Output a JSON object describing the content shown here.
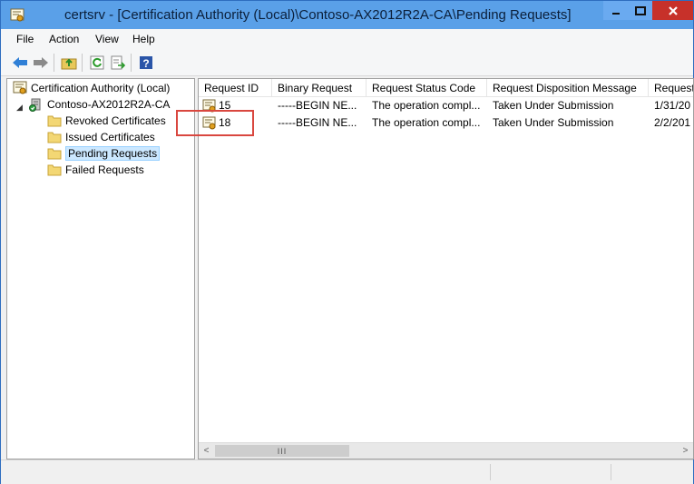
{
  "window": {
    "title": "certsrv - [Certification Authority (Local)\\Contoso-AX2012R2A-CA\\Pending Requests]"
  },
  "menu": [
    "File",
    "Action",
    "View",
    "Help"
  ],
  "toolbar": {
    "buttons": [
      "back-arrow-icon",
      "forward-arrow-icon",
      "up-folder-icon",
      "refresh-icon",
      "export-list-icon",
      "help-icon"
    ]
  },
  "tree": {
    "root": "Certification Authority (Local)",
    "ca": "Contoso-AX2012R2A-CA",
    "folders": [
      "Revoked Certificates",
      "Issued Certificates",
      "Pending Requests",
      "Failed Requests"
    ],
    "selected": "Pending Requests"
  },
  "list": {
    "columns": [
      "Request ID",
      "Binary Request",
      "Request Status Code",
      "Request Disposition Message",
      "Request"
    ],
    "rows": [
      [
        "15",
        "-----BEGIN NE...",
        "The operation compl...",
        "Taken Under Submission",
        "1/31/20"
      ],
      [
        "18",
        "-----BEGIN NE...",
        "The operation compl...",
        "Taken Under Submission",
        "2/2/201"
      ]
    ],
    "scroll_thumb": "III"
  },
  "colors": {
    "titlebar": "#5aa0e8",
    "close": "#c7312a",
    "highlight": "#d9473f",
    "selection": "#cce8ff"
  }
}
